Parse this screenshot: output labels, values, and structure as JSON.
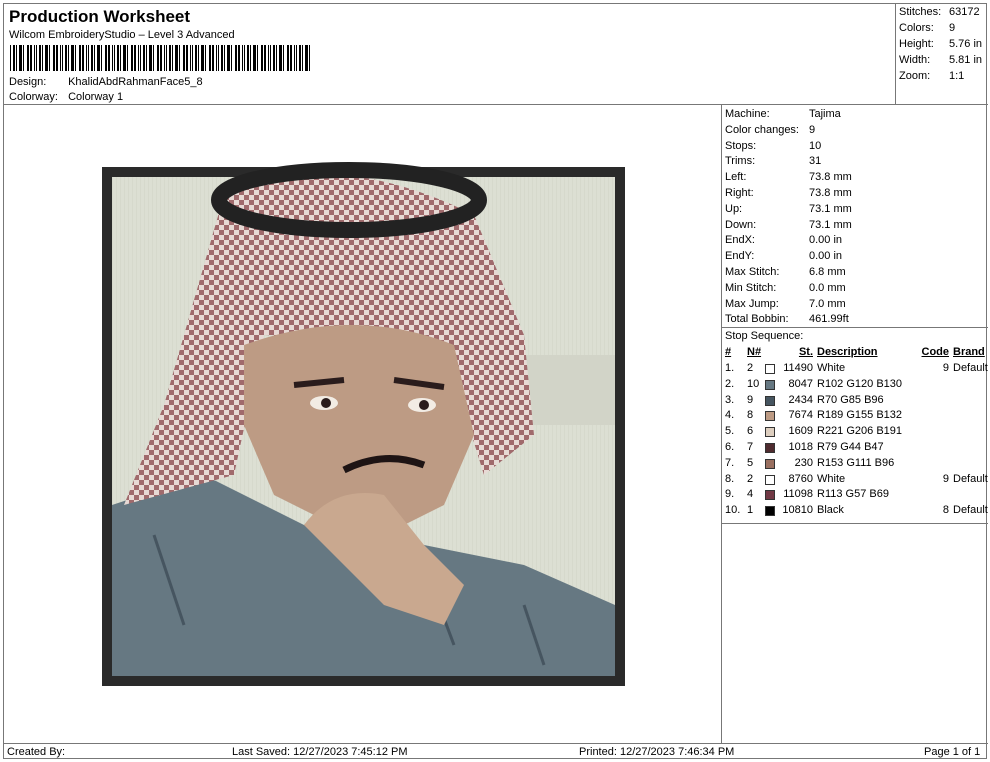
{
  "header": {
    "title": "Production Worksheet",
    "software": "Wilcom EmbroideryStudio – Level 3 Advanced",
    "design_label": "Design:",
    "design_value": "KhalidAbdRahmanFace5_8",
    "colorway_label": "Colorway:",
    "colorway_value": "Colorway 1"
  },
  "stats": [
    {
      "label": "Stitches:",
      "value": "63172"
    },
    {
      "label": "Colors:",
      "value": "9"
    },
    {
      "label": "Height:",
      "value": "5.76 in"
    },
    {
      "label": "Width:",
      "value": "5.81 in"
    },
    {
      "label": "Zoom:",
      "value": "1:1"
    }
  ],
  "machine_info": [
    {
      "label": "Machine:",
      "value": "Tajima"
    },
    {
      "label": "Color changes:",
      "value": "9"
    },
    {
      "label": "Stops:",
      "value": "10"
    },
    {
      "label": "Trims:",
      "value": "31"
    },
    {
      "label": "Left:",
      "value": "73.8 mm"
    },
    {
      "label": "Right:",
      "value": "73.8 mm"
    },
    {
      "label": "Up:",
      "value": "73.1 mm"
    },
    {
      "label": "Down:",
      "value": "73.1 mm"
    },
    {
      "label": "EndX:",
      "value": "0.00 in"
    },
    {
      "label": "EndY:",
      "value": "0.00 in"
    },
    {
      "label": "Max Stitch:",
      "value": "6.8 mm"
    },
    {
      "label": "Min Stitch:",
      "value": "0.0 mm"
    },
    {
      "label": "Max Jump:",
      "value": "7.0 mm"
    },
    {
      "label": "Total Bobbin:",
      "value": "461.99ft"
    }
  ],
  "stop_sequence": {
    "title": "Stop Sequence:",
    "headers": {
      "idx": "#",
      "n": "N#",
      "st": "St.",
      "desc": "Description",
      "code": "Code",
      "brand": "Brand"
    },
    "rows": [
      {
        "idx": "1.",
        "n": "2",
        "color": "#ffffff",
        "st": "11490",
        "desc": "White",
        "code": "9",
        "brand": "Default"
      },
      {
        "idx": "2.",
        "n": "10",
        "color": "#667882",
        "st": "8047",
        "desc": "R102 G120 B130",
        "code": "",
        "brand": ""
      },
      {
        "idx": "3.",
        "n": "9",
        "color": "#465560",
        "st": "2434",
        "desc": "R70 G85 B96",
        "code": "",
        "brand": ""
      },
      {
        "idx": "4.",
        "n": "8",
        "color": "#bd9b84",
        "st": "7674",
        "desc": "R189 G155 B132",
        "code": "",
        "brand": ""
      },
      {
        "idx": "5.",
        "n": "6",
        "color": "#ddcebf",
        "st": "1609",
        "desc": "R221 G206 B191",
        "code": "",
        "brand": ""
      },
      {
        "idx": "6.",
        "n": "7",
        "color": "#4f2c2f",
        "st": "1018",
        "desc": "R79 G44 B47",
        "code": "",
        "brand": ""
      },
      {
        "idx": "7.",
        "n": "5",
        "color": "#996f60",
        "st": "230",
        "desc": "R153 G111 B96",
        "code": "",
        "brand": ""
      },
      {
        "idx": "8.",
        "n": "2",
        "color": "#ffffff",
        "st": "8760",
        "desc": "White",
        "code": "9",
        "brand": "Default"
      },
      {
        "idx": "9.",
        "n": "4",
        "color": "#713945",
        "st": "11098",
        "desc": "R113 G57 B69",
        "code": "",
        "brand": ""
      },
      {
        "idx": "10.",
        "n": "1",
        "color": "#000000",
        "st": "10810",
        "desc": "Black",
        "code": "8",
        "brand": "Default"
      }
    ]
  },
  "footer": {
    "created_by": "Created By:",
    "last_saved": "Last Saved: 12/27/2023 7:45:12 PM",
    "printed": "Printed: 12/27/2023 7:46:34 PM",
    "page": "Page 1 of 1"
  },
  "colors": {
    "frame_border": "#2a2a2a",
    "background_fill": "#d9dccf",
    "shirt": "#667882",
    "skin": "#bd9b84",
    "shemagh_red": "#996f60",
    "agal": "#222222"
  }
}
